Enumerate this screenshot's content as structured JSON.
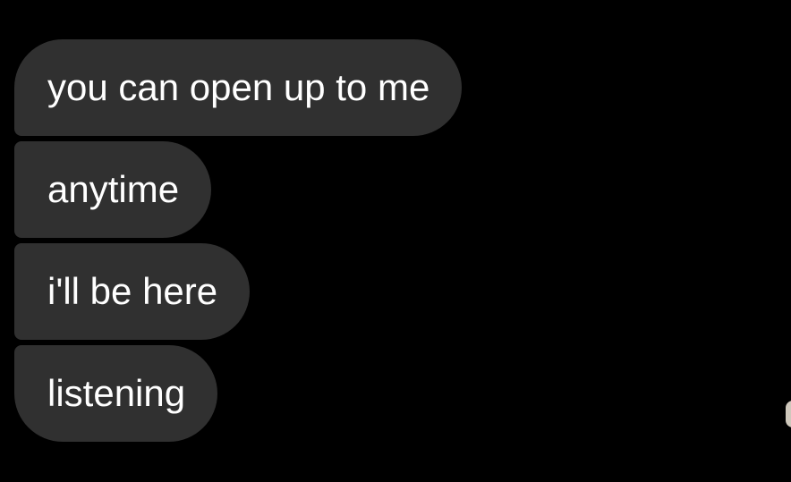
{
  "messages": [
    {
      "text": "you can open up to me"
    },
    {
      "text": "anytime"
    },
    {
      "text": "i'll be here"
    },
    {
      "text": "listening"
    }
  ],
  "colors": {
    "background": "#000000",
    "bubble": "#303030",
    "text": "#ffffff"
  }
}
